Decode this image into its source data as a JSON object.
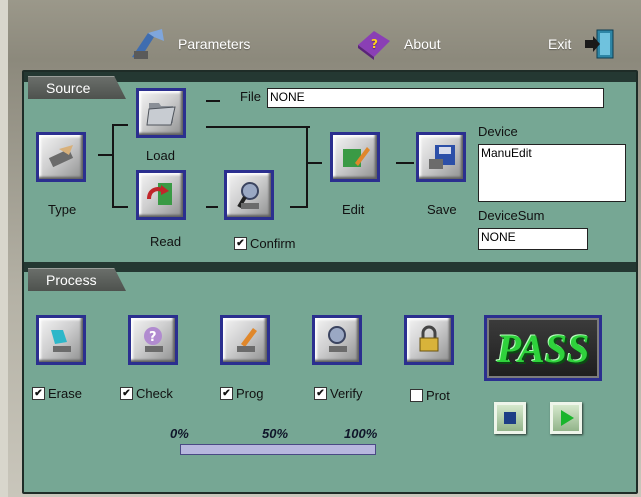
{
  "menu": {
    "parameters": "Parameters",
    "about": "About",
    "exit": "Exit"
  },
  "source": {
    "title": "Source",
    "file_label": "File",
    "file_value": "NONE",
    "load": "Load",
    "type": "Type",
    "read": "Read",
    "confirm": "Confirm",
    "confirm_checked": true,
    "edit": "Edit",
    "save": "Save",
    "device_label": "Device",
    "device_value": "ManuEdit",
    "devicesum_label": "DeviceSum",
    "devicesum_value": "NONE"
  },
  "process": {
    "title": "Process",
    "options": [
      {
        "label": "Erase",
        "checked": true,
        "icon": "erase-icon"
      },
      {
        "label": "Check",
        "checked": true,
        "icon": "check-icon"
      },
      {
        "label": "Prog",
        "checked": true,
        "icon": "prog-icon"
      },
      {
        "label": "Verify",
        "checked": true,
        "icon": "verify-icon"
      },
      {
        "label": "Prot",
        "checked": false,
        "icon": "prot-icon"
      }
    ],
    "status": "PASS",
    "status_color": "#2fd23c",
    "progress": {
      "label_0": "0%",
      "label_50": "50%",
      "label_100": "100%",
      "value_percent": 0
    }
  }
}
